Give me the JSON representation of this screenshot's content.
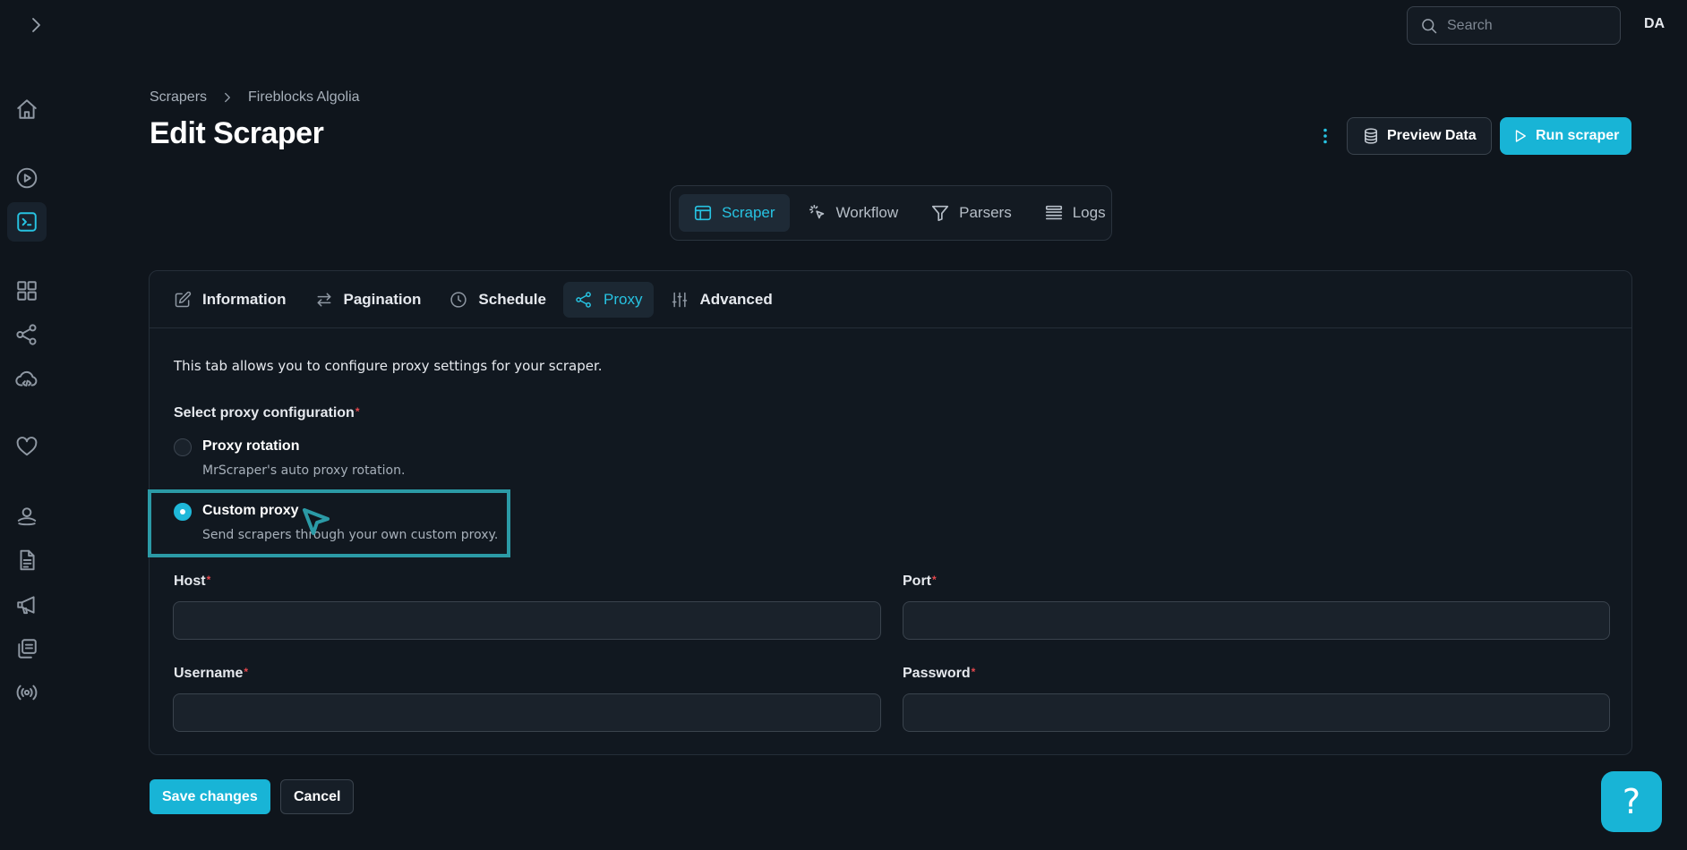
{
  "topbar": {
    "search_placeholder": "Search",
    "avatar_initials": "DA"
  },
  "sidebar": {
    "items": [
      {
        "name": "home",
        "icon": "home-icon",
        "active": false
      },
      {
        "name": "runs",
        "icon": "play-circle-icon",
        "active": false
      },
      {
        "name": "scrapers",
        "icon": "terminal-icon",
        "active": true
      },
      {
        "name": "apps",
        "icon": "grid-icon",
        "active": false
      },
      {
        "name": "share",
        "icon": "share-icon",
        "active": false
      },
      {
        "name": "cloud-code",
        "icon": "cloud-code-icon",
        "active": false
      },
      {
        "name": "favorites",
        "icon": "heart-icon",
        "active": false
      },
      {
        "name": "account",
        "icon": "user-icon",
        "active": false
      },
      {
        "name": "docs",
        "icon": "document-icon",
        "active": false
      },
      {
        "name": "announcements",
        "icon": "megaphone-icon",
        "active": false
      },
      {
        "name": "copies",
        "icon": "copy-icon",
        "active": false
      },
      {
        "name": "broadcast",
        "icon": "broadcast-icon",
        "active": false
      }
    ]
  },
  "breadcrumb": {
    "root": "Scrapers",
    "current": "Fireblocks Algolia"
  },
  "header": {
    "title": "Edit Scraper",
    "preview_label": "Preview Data",
    "run_label": "Run scraper"
  },
  "main_tabs": [
    {
      "label": "Scraper",
      "icon": "window-icon",
      "active": true
    },
    {
      "label": "Workflow",
      "icon": "pointer-click-icon",
      "active": false
    },
    {
      "label": "Parsers",
      "icon": "filter-icon",
      "active": false
    },
    {
      "label": "Logs",
      "icon": "list-icon",
      "active": false
    }
  ],
  "sub_tabs": [
    {
      "label": "Information",
      "icon": "edit-icon",
      "active": false
    },
    {
      "label": "Pagination",
      "icon": "arrows-icon",
      "active": false
    },
    {
      "label": "Schedule",
      "icon": "clock-icon",
      "active": false
    },
    {
      "label": "Proxy",
      "icon": "share-icon",
      "active": true
    },
    {
      "label": "Advanced",
      "icon": "sliders-icon",
      "active": false
    }
  ],
  "proxy": {
    "description": "This tab allows you to configure proxy settings for your scraper.",
    "config_label": "Select proxy configuration",
    "required_mark": "*",
    "options": [
      {
        "title": "Proxy rotation",
        "desc": "MrScraper's auto proxy rotation.",
        "checked": false
      },
      {
        "title": "Custom proxy",
        "desc": "Send scrapers through your own custom proxy.",
        "checked": true
      }
    ],
    "host_label": "Host",
    "host_value": "",
    "port_label": "Port",
    "port_value": "",
    "username_label": "Username",
    "username_value": "",
    "password_label": "Password",
    "password_value": ""
  },
  "footer": {
    "save_label": "Save changes",
    "cancel_label": "Cancel"
  },
  "help": {
    "label": "?"
  },
  "colors": {
    "accent": "#18b4d6",
    "background": "#0f151c",
    "required": "#e5484d"
  }
}
